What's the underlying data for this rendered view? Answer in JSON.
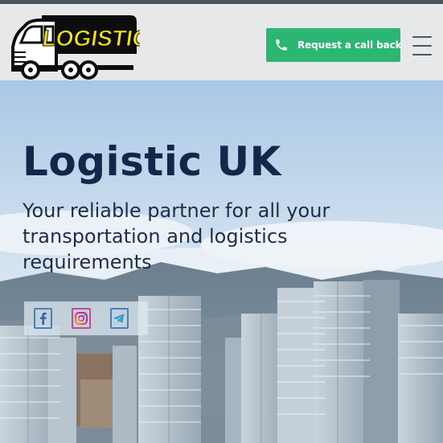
{
  "header": {
    "logo_text": "LOGISTIC",
    "cta_label": "Request a call back",
    "menu_icon": "hamburger-menu-icon",
    "phone_icon": "phone-icon"
  },
  "hero": {
    "title": "Logistic UK",
    "subtitle_lines": [
      "Your reliable partner for all your",
      "transportation and logistics",
      "requirements"
    ]
  },
  "social": {
    "icons": [
      "facebook-icon",
      "instagram-icon",
      "telegram-icon"
    ]
  },
  "colors": {
    "cta_green": "#2bb673",
    "title_navy": "#12284a",
    "logo_yellow": "#f2e21a",
    "header_bg": "#e7e8ea"
  }
}
